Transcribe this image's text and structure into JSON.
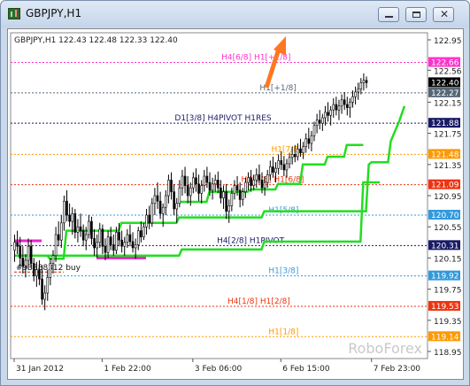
{
  "window": {
    "title": "GBPJPY,H1"
  },
  "icons": {
    "app": "chart-window-icon",
    "minimize": "minimize-icon",
    "maximize": "maximize-icon",
    "close": "close-icon",
    "arrow": "up-arrow-icon"
  },
  "chart_data": {
    "type": "candlestick",
    "header": "GBPJPY,H1  122.43 122.48 122.33 122.40",
    "watermark": "RoboForex",
    "ylim": [
      118.95,
      122.95
    ],
    "y_ticks": [
      "122.95",
      "122.56",
      "122.15",
      "121.75",
      "121.35",
      "120.95",
      "120.55",
      "120.15",
      "119.75",
      "119.35",
      "118.95"
    ],
    "x_ticks": [
      {
        "label": "31 Jan 2012",
        "bar": 0
      },
      {
        "label": "1 Feb 22:00",
        "bar": 32
      },
      {
        "label": "3 Feb 06:00",
        "bar": 65
      },
      {
        "label": "6 Feb 15:00",
        "bar": 97
      },
      {
        "label": "7 Feb 23:00",
        "bar": 130
      }
    ],
    "total_bars": 142,
    "levels": [
      {
        "price": 122.66,
        "price_label": "122.66",
        "text": "H4[6/8] H1[+2/8]",
        "color": "#ff33cc",
        "label_bar": 88
      },
      {
        "price": 122.27,
        "price_label": "122.27",
        "text": "H1[+1/8]",
        "color": "#556677",
        "label_bar": 96
      },
      {
        "price": 121.88,
        "price_label": "121.88",
        "text": "D1[3/8] H4PIVOT H1RES",
        "color": "#1a1a66",
        "label_bar": 76
      },
      {
        "price": 121.48,
        "price_label": "121.48",
        "text": "H1[7/8]",
        "color": "#ff9900",
        "label_bar": 99
      },
      {
        "price": 121.09,
        "price_label": "121.09",
        "text": "H4[5/8] H1[6/8]",
        "color": "#ee3311",
        "label_bar": 94
      },
      {
        "price": 120.7,
        "price_label": "120.70",
        "text": "H1[5/8]",
        "color": "#3399dd",
        "label_bar": 98
      },
      {
        "price": 120.31,
        "price_label": "120.31",
        "text": "H4[2/8] H1PIVOT",
        "color": "#1a1a66",
        "label_bar": 86
      },
      {
        "price": 119.92,
        "price_label": "119.92",
        "text": "H1[3/8]",
        "color": "#3399dd",
        "label_bar": 98
      },
      {
        "price": 119.53,
        "price_label": "119.53",
        "text": "H4[1/8] H1[2/8]",
        "color": "#ee3311",
        "label_bar": 89
      },
      {
        "price": 119.14,
        "price_label": "119.14",
        "text": "H1[1/8]",
        "color": "#ff9900",
        "label_bar": 98
      }
    ],
    "current_price": {
      "value": 122.4,
      "label": "122.40"
    },
    "trade": {
      "text": "#93888312 buy",
      "price": 119.97,
      "from_bar": 0,
      "to_bar": 18
    },
    "pink_line": [
      {
        "from_bar": 0,
        "to_bar": 10,
        "price": 120.37
      },
      {
        "from_bar": 30,
        "to_bar": 48,
        "price": 120.15
      }
    ],
    "green_lines": [
      {
        "name": "H1 lower",
        "points": [
          [
            0,
            120.18
          ],
          [
            12,
            120.18
          ],
          [
            13,
            120.14
          ],
          [
            18,
            120.14
          ],
          [
            19,
            120.5
          ],
          [
            38,
            120.5
          ],
          [
            39,
            120.6
          ],
          [
            59,
            120.6
          ],
          [
            60,
            120.67
          ],
          [
            90,
            120.67
          ],
          [
            91,
            120.75
          ],
          [
            128,
            120.75
          ],
          [
            129,
            121.35
          ],
          [
            130,
            121.38
          ],
          [
            136,
            121.38
          ],
          [
            137,
            121.65
          ],
          [
            140,
            121.9
          ],
          [
            142,
            122.1
          ]
        ]
      },
      {
        "name": "H4 lower",
        "points": [
          [
            0,
            120.18
          ],
          [
            60,
            120.18
          ],
          [
            61,
            120.26
          ],
          [
            90,
            120.26
          ],
          [
            91,
            120.36
          ],
          [
            126,
            120.36
          ],
          [
            127,
            121.12
          ],
          [
            133,
            121.12
          ]
        ]
      },
      {
        "name": "H1 mid",
        "points": [
          [
            60,
            120.87
          ],
          [
            70,
            120.87
          ],
          [
            71,
            121.0
          ],
          [
            85,
            121.0
          ],
          [
            86,
            121.03
          ],
          [
            95,
            121.03
          ],
          [
            96,
            121.1
          ],
          [
            104,
            121.1
          ],
          [
            105,
            121.35
          ],
          [
            113,
            121.35
          ],
          [
            114,
            121.45
          ],
          [
            120,
            121.45
          ],
          [
            121,
            121.6
          ],
          [
            127,
            121.6
          ]
        ]
      }
    ],
    "candles": [
      [
        120.25,
        120.45,
        120.1,
        120.35
      ],
      [
        120.35,
        120.5,
        120.2,
        120.3
      ],
      [
        120.3,
        120.42,
        120.05,
        120.15
      ],
      [
        120.15,
        120.3,
        119.95,
        120.05
      ],
      [
        120.05,
        120.2,
        119.9,
        120.12
      ],
      [
        120.12,
        120.4,
        120.0,
        120.3
      ],
      [
        120.3,
        120.38,
        120.02,
        120.08
      ],
      [
        120.08,
        120.15,
        119.85,
        119.92
      ],
      [
        119.92,
        120.1,
        119.78,
        120.0
      ],
      [
        120.0,
        120.12,
        119.8,
        119.88
      ],
      [
        119.88,
        120.05,
        119.55,
        119.62
      ],
      [
        119.62,
        119.8,
        119.48,
        119.7
      ],
      [
        119.7,
        120.0,
        119.6,
        119.9
      ],
      [
        119.9,
        120.15,
        119.8,
        120.08
      ],
      [
        120.08,
        120.25,
        119.95,
        120.18
      ],
      [
        120.18,
        120.55,
        120.1,
        120.45
      ],
      [
        120.45,
        120.62,
        120.3,
        120.38
      ],
      [
        120.38,
        120.7,
        120.28,
        120.6
      ],
      [
        120.6,
        120.95,
        120.5,
        120.88
      ],
      [
        120.88,
        121.02,
        120.62,
        120.7
      ],
      [
        120.7,
        120.85,
        120.55,
        120.62
      ],
      [
        120.62,
        120.8,
        120.45,
        120.72
      ],
      [
        120.72,
        120.78,
        120.4,
        120.48
      ],
      [
        120.48,
        120.65,
        120.35,
        120.55
      ],
      [
        120.55,
        120.72,
        120.42,
        120.5
      ],
      [
        120.5,
        120.58,
        120.3,
        120.38
      ],
      [
        120.38,
        120.55,
        120.25,
        120.45
      ],
      [
        120.45,
        120.7,
        120.4,
        120.62
      ],
      [
        120.62,
        120.68,
        120.32,
        120.4
      ],
      [
        120.4,
        120.52,
        120.18,
        120.28
      ],
      [
        120.28,
        120.45,
        120.15,
        120.35
      ],
      [
        120.35,
        120.6,
        120.28,
        120.52
      ],
      [
        120.52,
        120.58,
        120.2,
        120.3
      ],
      [
        120.3,
        120.4,
        120.12,
        120.22
      ],
      [
        120.22,
        120.5,
        120.15,
        120.42
      ],
      [
        120.42,
        120.55,
        120.25,
        120.32
      ],
      [
        120.32,
        120.45,
        120.18,
        120.25
      ],
      [
        120.25,
        120.55,
        120.2,
        120.48
      ],
      [
        120.48,
        120.6,
        120.3,
        120.38
      ],
      [
        120.38,
        120.5,
        120.22,
        120.3
      ],
      [
        120.3,
        120.42,
        120.18,
        120.35
      ],
      [
        120.35,
        120.52,
        120.28,
        120.45
      ],
      [
        120.45,
        120.58,
        120.3,
        120.36
      ],
      [
        120.36,
        120.48,
        120.22,
        120.28
      ],
      [
        120.28,
        120.4,
        120.14,
        120.32
      ],
      [
        120.32,
        120.55,
        120.25,
        120.5
      ],
      [
        120.5,
        120.62,
        120.35,
        120.42
      ],
      [
        120.42,
        120.6,
        120.38,
        120.55
      ],
      [
        120.55,
        120.78,
        120.45,
        120.7
      ],
      [
        120.7,
        120.82,
        120.52,
        120.6
      ],
      [
        120.6,
        120.92,
        120.55,
        120.85
      ],
      [
        120.85,
        121.05,
        120.7,
        120.95
      ],
      [
        120.95,
        121.12,
        120.78,
        120.88
      ],
      [
        120.88,
        121.0,
        120.65,
        120.72
      ],
      [
        120.72,
        120.85,
        120.55,
        120.8
      ],
      [
        120.8,
        121.02,
        120.7,
        120.95
      ],
      [
        120.95,
        121.22,
        120.85,
        121.15
      ],
      [
        121.15,
        121.25,
        120.9,
        121.0
      ],
      [
        121.0,
        121.1,
        120.7,
        120.78
      ],
      [
        120.78,
        120.92,
        120.6,
        120.85
      ],
      [
        120.85,
        121.15,
        120.8,
        121.05
      ],
      [
        121.05,
        121.28,
        120.95,
        121.2
      ],
      [
        121.2,
        121.32,
        120.98,
        121.08
      ],
      [
        121.08,
        121.2,
        120.85,
        120.95
      ],
      [
        120.95,
        121.12,
        120.82,
        121.05
      ],
      [
        121.05,
        121.25,
        120.98,
        121.18
      ],
      [
        121.18,
        121.3,
        121.0,
        121.1
      ],
      [
        121.1,
        121.22,
        120.88,
        120.98
      ],
      [
        120.98,
        121.15,
        120.85,
        121.08
      ],
      [
        121.08,
        121.28,
        121.0,
        121.2
      ],
      [
        121.2,
        121.32,
        121.05,
        121.12
      ],
      [
        121.12,
        121.25,
        120.95,
        121.02
      ],
      [
        121.02,
        121.18,
        120.9,
        121.1
      ],
      [
        121.1,
        121.22,
        121.0,
        121.15
      ],
      [
        121.15,
        121.26,
        120.98,
        121.05
      ],
      [
        121.05,
        121.15,
        120.85,
        120.92
      ],
      [
        120.92,
        121.08,
        120.78,
        121.0
      ],
      [
        121.0,
        121.1,
        120.65,
        120.75
      ],
      [
        120.75,
        120.9,
        120.6,
        120.82
      ],
      [
        120.82,
        121.05,
        120.75,
        120.98
      ],
      [
        120.98,
        121.15,
        120.9,
        121.08
      ],
      [
        121.08,
        121.2,
        120.95,
        121.02
      ],
      [
        121.02,
        121.12,
        120.8,
        120.9
      ],
      [
        120.9,
        121.05,
        120.82,
        121.0
      ],
      [
        121.0,
        121.18,
        120.92,
        121.12
      ],
      [
        121.12,
        121.25,
        121.02,
        121.18
      ],
      [
        121.18,
        121.28,
        121.0,
        121.08
      ],
      [
        121.08,
        121.22,
        121.02,
        121.15
      ],
      [
        121.15,
        121.3,
        121.05,
        121.22
      ],
      [
        121.22,
        121.35,
        121.1,
        121.15
      ],
      [
        121.15,
        121.25,
        120.98,
        121.05
      ],
      [
        121.05,
        121.2,
        120.95,
        121.12
      ],
      [
        121.12,
        121.28,
        121.05,
        121.22
      ],
      [
        121.22,
        121.4,
        121.15,
        121.32
      ],
      [
        121.32,
        121.45,
        121.18,
        121.25
      ],
      [
        121.25,
        121.38,
        121.12,
        121.3
      ],
      [
        121.3,
        121.48,
        121.22,
        121.4
      ],
      [
        121.4,
        121.52,
        121.28,
        121.35
      ],
      [
        121.35,
        121.46,
        121.2,
        121.28
      ],
      [
        121.28,
        121.42,
        121.18,
        121.36
      ],
      [
        121.36,
        121.5,
        121.3,
        121.44
      ],
      [
        121.44,
        121.58,
        121.35,
        121.48
      ],
      [
        121.48,
        121.6,
        121.38,
        121.45
      ],
      [
        121.45,
        121.62,
        121.4,
        121.55
      ],
      [
        121.55,
        121.68,
        121.45,
        121.5
      ],
      [
        121.5,
        121.64,
        121.42,
        121.58
      ],
      [
        121.58,
        121.75,
        121.5,
        121.68
      ],
      [
        121.68,
        121.82,
        121.55,
        121.62
      ],
      [
        121.62,
        121.78,
        121.52,
        121.72
      ],
      [
        121.72,
        121.9,
        121.65,
        121.85
      ],
      [
        121.85,
        122.0,
        121.75,
        121.92
      ],
      [
        121.92,
        122.05,
        121.8,
        121.88
      ],
      [
        121.88,
        122.0,
        121.78,
        121.95
      ],
      [
        121.95,
        122.1,
        121.85,
        122.02
      ],
      [
        122.02,
        122.15,
        121.9,
        121.98
      ],
      [
        121.98,
        122.1,
        121.85,
        122.05
      ],
      [
        122.05,
        122.2,
        121.95,
        122.12
      ],
      [
        122.12,
        122.22,
        121.98,
        122.05
      ],
      [
        122.05,
        122.18,
        121.92,
        122.1
      ],
      [
        122.1,
        122.25,
        122.0,
        122.18
      ],
      [
        122.18,
        122.28,
        122.05,
        122.12
      ],
      [
        122.12,
        122.22,
        121.98,
        122.08
      ],
      [
        122.08,
        122.2,
        121.95,
        122.15
      ],
      [
        122.15,
        122.3,
        122.08,
        122.22
      ],
      [
        122.22,
        122.35,
        122.12,
        122.28
      ],
      [
        122.28,
        122.4,
        122.18,
        122.32
      ],
      [
        122.32,
        122.46,
        122.25,
        122.4
      ],
      [
        122.4,
        122.52,
        122.3,
        122.43
      ],
      [
        122.43,
        122.48,
        122.33,
        122.4
      ]
    ]
  }
}
